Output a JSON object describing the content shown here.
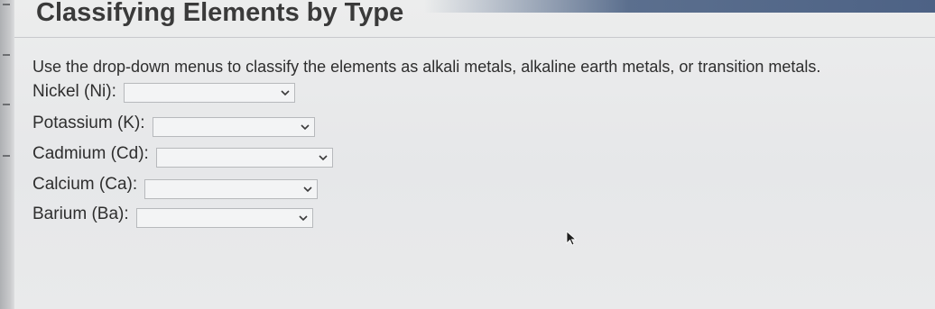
{
  "page": {
    "title": "Classifying Elements by Type",
    "instructions": "Use the drop-down menus to classify the elements as alkali metals, alkaline earth metals, or transition metals."
  },
  "rows": [
    {
      "label": "Nickel (Ni):",
      "selected": ""
    },
    {
      "label": "Potassium (K):",
      "selected": ""
    },
    {
      "label": "Cadmium (Cd):",
      "selected": ""
    },
    {
      "label": "Calcium (Ca):",
      "selected": ""
    },
    {
      "label": "Barium (Ba):",
      "selected": ""
    }
  ],
  "icons": {
    "dropdown": "chevron-down-icon",
    "pointer": "mouse-pointer-icon"
  },
  "colors": {
    "text": "#2e2e2e",
    "background": "#e9eaec",
    "select_border": "#b7b9bc",
    "chevron": "#3a3a3a"
  }
}
